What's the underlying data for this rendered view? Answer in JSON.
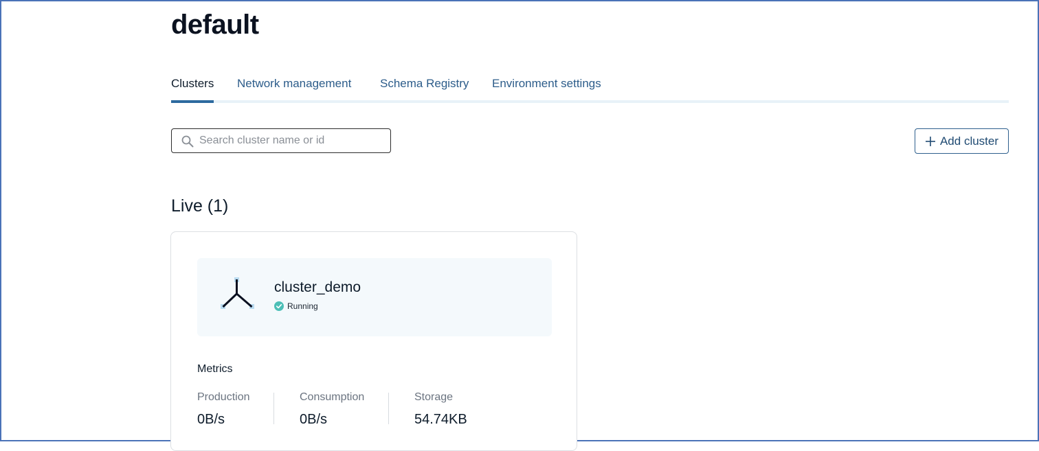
{
  "page": {
    "title": "default"
  },
  "tabs": [
    {
      "label": "Clusters",
      "active": true
    },
    {
      "label": "Network management",
      "active": false
    },
    {
      "label": "Schema Registry",
      "active": false
    },
    {
      "label": "Environment settings",
      "active": false
    }
  ],
  "search": {
    "placeholder": "Search cluster name or id",
    "value": "",
    "icon": "search-icon"
  },
  "toolbar": {
    "add_cluster_label": "Add cluster",
    "add_icon": "plus-icon"
  },
  "section": {
    "title": "Live (1)"
  },
  "cluster": {
    "name": "cluster_demo",
    "status": "Running",
    "icon": "cluster-icon",
    "status_icon": "check-circle-icon",
    "metrics_title": "Metrics",
    "metrics": [
      {
        "label": "Production",
        "value": "0B/s"
      },
      {
        "label": "Consumption",
        "value": "0B/s"
      },
      {
        "label": "Storage",
        "value": "54.74KB"
      }
    ]
  },
  "colors": {
    "accent": "#2d6a9f",
    "tab_text": "#2c5c8a",
    "status_ok": "#4cbfb7",
    "frame": "#4a72b8"
  }
}
